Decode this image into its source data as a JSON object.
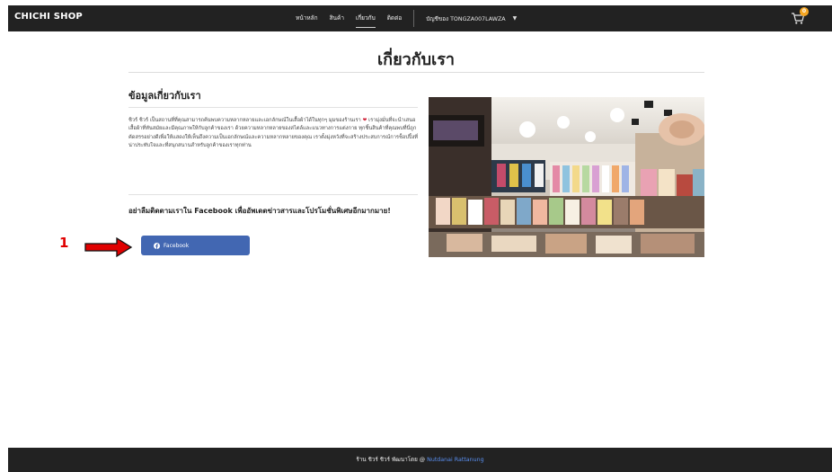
{
  "navbar": {
    "brand": "CHICHI SHOP",
    "links": [
      {
        "label": "หน้าหลัก"
      },
      {
        "label": "สินค้า"
      },
      {
        "label": "เกี่ยวกับ"
      },
      {
        "label": "ติดต่อ"
      }
    ],
    "active_index": 2,
    "account_label": "บัญชีของ TONGZA007LAWZA",
    "account_caret": "▼",
    "cart_icon": "cart-icon",
    "cart_count": "0"
  },
  "page": {
    "title": "เกี่ยวกับเรา",
    "section_heading": "ข้อมูลเกี่ยวกับเรา",
    "about_text_1": "ชิวร์ ชิวร์ เป็นสถานที่ที่คุณสามารถค้นพบความหลากหลายและเอกลักษณ์ในเสื้อผ้าได้ในทุกๆ มุมของร้านเรา",
    "about_text_2": "เรามุ่งมั่นที่จะนำเสนอเสื้อผ้าที่ทันสมัยและมีคุณภาพให้กับลูกค้าของเรา ด้วยความหลากหลายของสไตล์และแนวทางการแต่งกาย ทุกชิ้นสินค้าที่คุณพบที่นี่ถูกคัดสรรอย่างดีเพื่อให้แสดงให้เห็นถึงความเป็นเอกลักษณ์และความหลากหลายของคุณ เราตั้งมุ่งหวังที่จะสร้างประสบการณ์การช็อปปิ้งที่น่าประทับใจและที่สนุกสนานสำหรับลูกค้าของเราทุกท่าน",
    "heart": "❤",
    "follow_text": "อย่าลืมติดตามเราใน Facebook เพื่ออัพเดตข่าวสารและโปรโมชั่นพิเศษอีกมากมาย!",
    "facebook_button": "Facebook",
    "facebook_icon": "facebook-icon",
    "photo_icon": "clothing-store-photo"
  },
  "annotation": {
    "number": "1",
    "arrow_color": "#e00000"
  },
  "footer": {
    "text": "ร้าน ชิวร์ ชิวร์ พัฒนาโดย @",
    "author_link": "Nutdanai Rattanung"
  },
  "colors": {
    "navbar_bg": "#222222",
    "facebook_blue": "#4267b2",
    "badge": "#f5a623",
    "link": "#5a8ff0"
  }
}
